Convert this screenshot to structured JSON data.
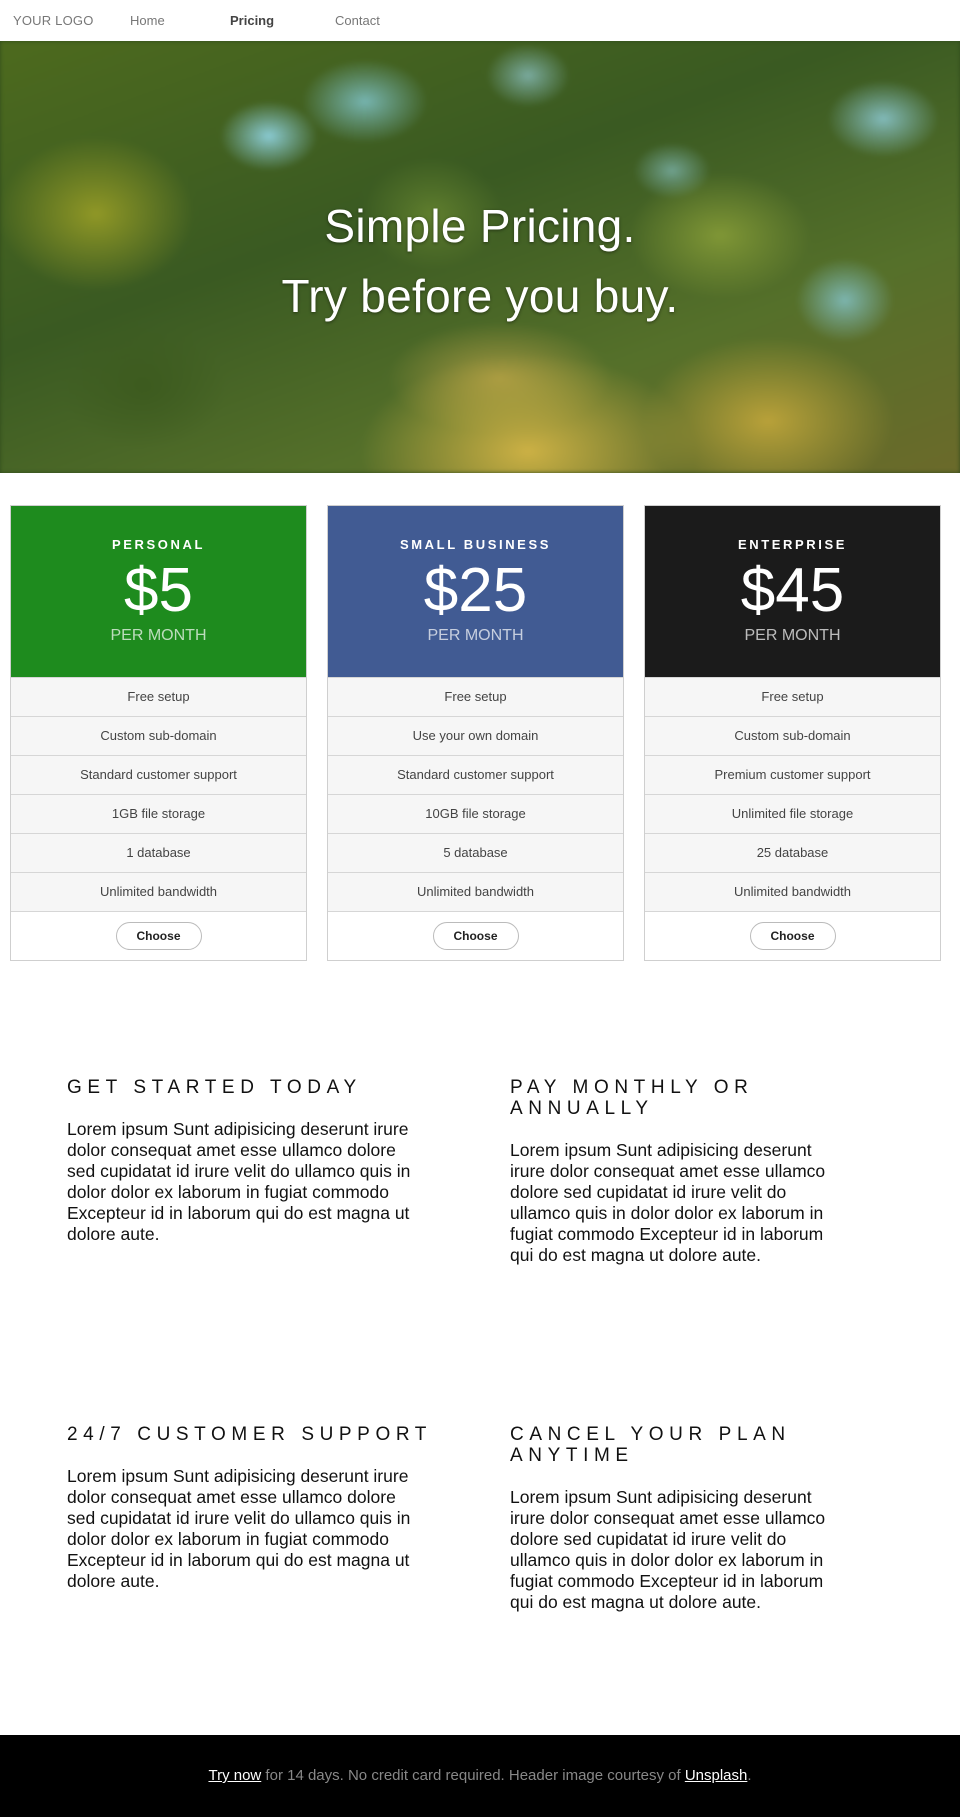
{
  "nav": {
    "logo": "YOUR LOGO",
    "home": "Home",
    "pricing": "Pricing",
    "contact": "Contact"
  },
  "hero": {
    "line1": "Simple Pricing.",
    "line2": "Try before you buy."
  },
  "plans": [
    {
      "name": "PERSONAL",
      "price": "$5",
      "period": "PER MONTH",
      "color": "#1e8b1e",
      "features": [
        "Free setup",
        "Custom sub-domain",
        "Standard customer support",
        "1GB file storage",
        "1 database",
        "Unlimited bandwidth"
      ],
      "button": "Choose"
    },
    {
      "name": "SMALL BUSINESS",
      "price": "$25",
      "period": "PER MONTH",
      "color": "#415b93",
      "features": [
        "Free setup",
        "Use your own domain",
        "Standard customer support",
        "10GB file storage",
        "5 database",
        "Unlimited bandwidth"
      ],
      "button": "Choose"
    },
    {
      "name": "ENTERPRISE",
      "price": "$45",
      "period": "PER MONTH",
      "color": "#1b1b1b",
      "features": [
        "Free setup",
        "Custom sub-domain",
        "Premium customer support",
        "Unlimited file storage",
        "25 database",
        "Unlimited bandwidth"
      ],
      "button": "Choose"
    }
  ],
  "info": [
    {
      "title": "GET STARTED TODAY",
      "text": "Lorem ipsum Sunt adipisicing deserunt irure dolor consequat amet esse ullamco dolore sed cupidatat id irure velit do ullamco quis in dolor dolor ex laborum in fugiat commodo Excepteur id in laborum qui do est magna ut dolore aute."
    },
    {
      "title": "PAY MONTHLY OR ANNUALLY",
      "text": "Lorem ipsum Sunt adipisicing deserunt irure dolor consequat amet esse ullamco dolore sed cupidatat id irure velit do ullamco quis in dolor dolor ex laborum in fugiat commodo Excepteur id in laborum qui do est magna ut dolore aute."
    },
    {
      "title": "24/7 CUSTOMER SUPPORT",
      "text": "Lorem ipsum Sunt adipisicing deserunt irure dolor consequat amet esse ullamco dolore sed cupidatat id irure velit do ullamco quis in dolor dolor ex laborum in fugiat commodo Excepteur id in laborum qui do est magna ut dolore aute."
    },
    {
      "title": "CANCEL YOUR PLAN ANYTIME",
      "text": "Lorem ipsum Sunt adipisicing deserunt irure dolor consequat amet esse ullamco dolore sed cupidatat id irure velit do ullamco quis in dolor dolor ex laborum in fugiat commodo Excepteur id in laborum qui do est magna ut dolore aute."
    }
  ],
  "footer": {
    "try_now": "Try now",
    "middle": " for 14 days. No credit card required. Header image courtesy of ",
    "unsplash": "Unsplash",
    "end": "."
  }
}
